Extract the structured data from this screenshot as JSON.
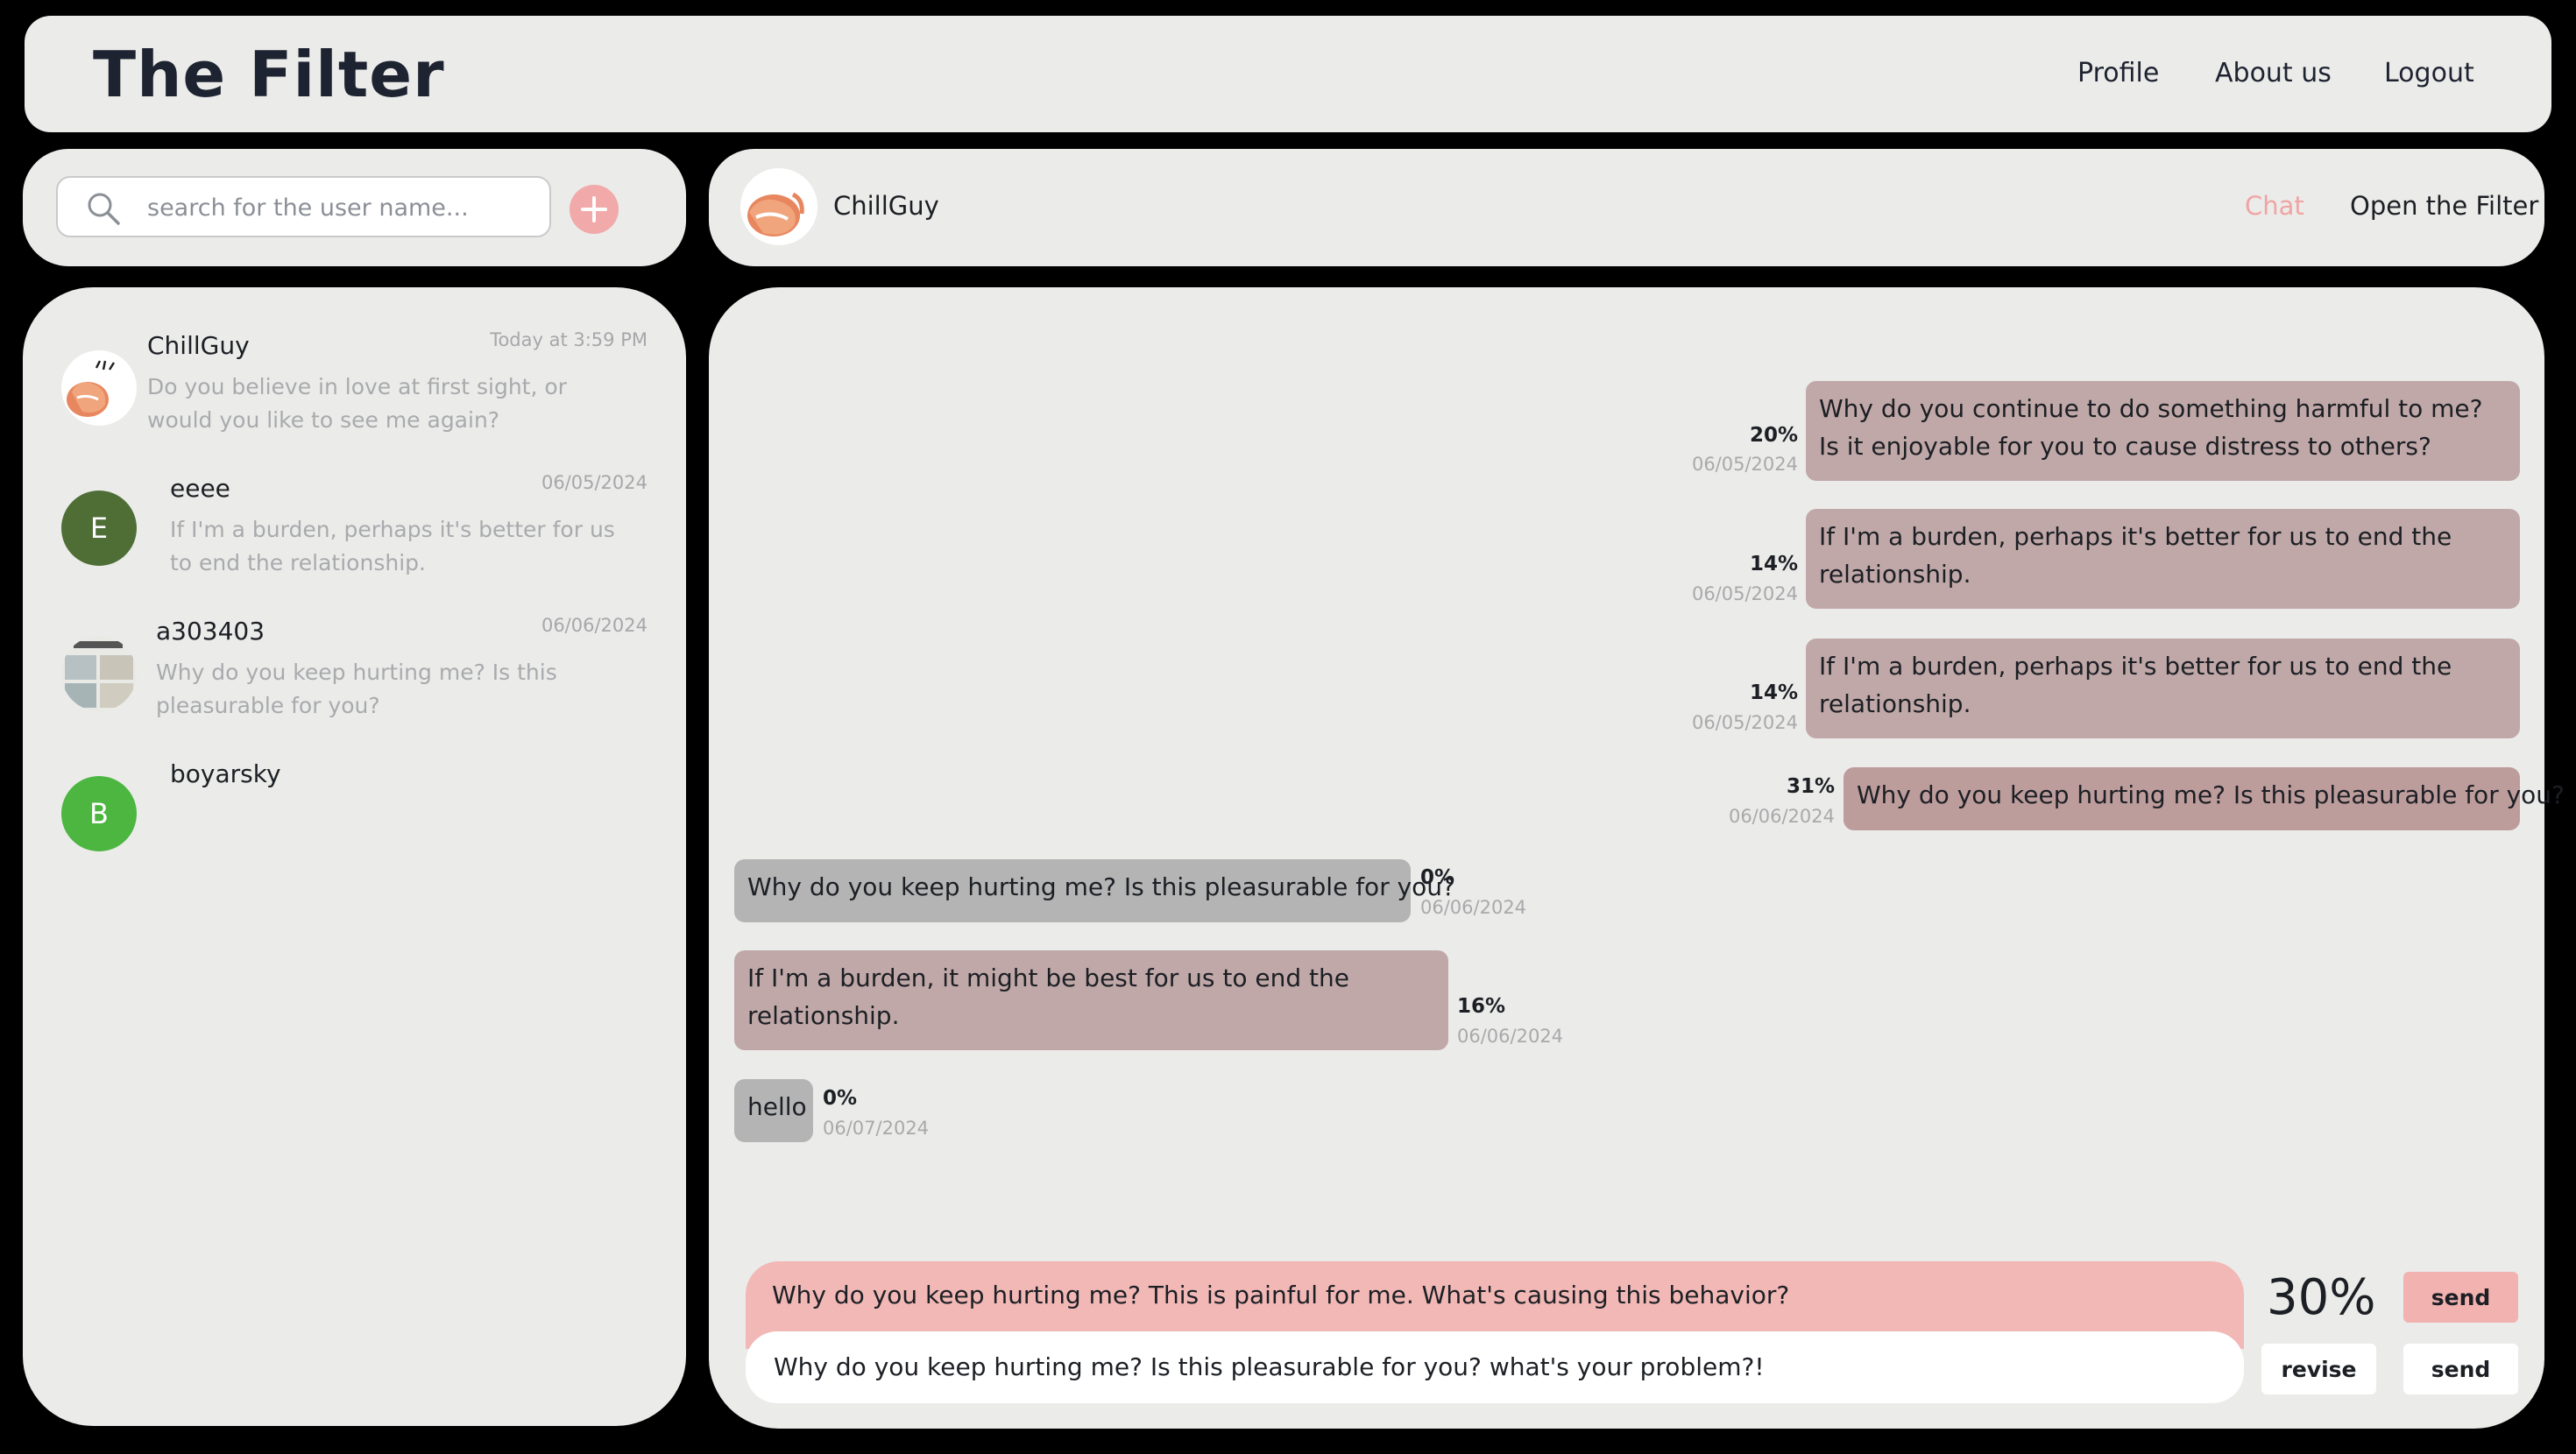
{
  "header": {
    "title": "The Filter",
    "nav": {
      "profile": "Profile",
      "about": "About us",
      "logout": "Logout"
    }
  },
  "search": {
    "placeholder": "search for the user name...",
    "value": ""
  },
  "contacts": [
    {
      "name": "ChillGuy",
      "time": "Today at 3:59 PM",
      "preview": "Do you believe in love at first sight, or would you like to see me again?",
      "avatar": "chillguy-illustration"
    },
    {
      "name": "eeee",
      "time": "06/05/2024",
      "preview": "If I'm a burden, perhaps it's better for us to end the relationship.",
      "initial": "E",
      "color": "#4e6e36"
    },
    {
      "name": "a303403",
      "time": "06/06/2024",
      "preview": "Why do you keep hurting me? Is this pleasurable for you?",
      "avatar": "photo-collage"
    },
    {
      "name": "boyarsky",
      "time": "",
      "preview": "",
      "initial": "B",
      "color": "#4cb640"
    }
  ],
  "chat": {
    "username": "ChillGuy",
    "tabs": {
      "chat": "Chat",
      "filter": "Open the Filter"
    },
    "accent": "#f0a4a4"
  },
  "messages": [
    {
      "side": "sent",
      "text": "Why do you continue to do something harmful to me? Is it enjoyable for you to cause distress to others?",
      "score": "20%",
      "date": "06/05/2024"
    },
    {
      "side": "sent",
      "text": "If I'm a burden, perhaps it's better for us to end the relationship.",
      "score": "14%",
      "date": "06/05/2024"
    },
    {
      "side": "sent",
      "text": "If I'm a burden, perhaps it's better for us to end the relationship.",
      "score": "14%",
      "date": "06/05/2024"
    },
    {
      "side": "sent",
      "text": "Why do you keep hurting me? Is this pleasurable for you?",
      "score": "31%",
      "date": "06/06/2024"
    },
    {
      "side": "received",
      "text": "Why do you keep hurting me? Is this pleasurable for you?",
      "score": "0%",
      "date": "06/06/2024"
    },
    {
      "side": "received",
      "text": "If I'm a burden, it might be best for us to end the relationship.",
      "score": "16%",
      "date": "06/06/2024"
    },
    {
      "side": "received",
      "text": "hello",
      "score": "0%",
      "date": "06/07/2024"
    }
  ],
  "composer": {
    "suggestion": "Why do you keep hurting me? This is painful for me. What's causing this behavior?",
    "suggestion_score": "30%",
    "input_value": "Why do you keep hurting me? Is this pleasurable for you? what's your problem?!",
    "send_label": "send",
    "revise_label": "revise"
  },
  "colors": {
    "panel": "#ebebe9",
    "sent_bubble": "#c0a8a8",
    "received_bubble": "#b4b4b4",
    "suggestion": "#f1b8b6"
  }
}
